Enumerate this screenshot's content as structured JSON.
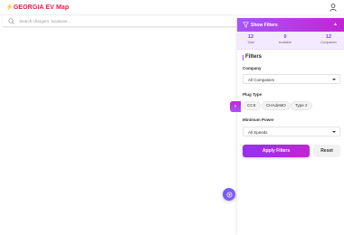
{
  "header": {
    "logo_text": "⚡GEORGIA EV Map",
    "user_icon": "user-icon"
  },
  "search": {
    "placeholder": "Search chargers, locations..."
  },
  "panel": {
    "title": "Show Filters",
    "collapse_glyph": "▲",
    "stats": [
      {
        "value": "12",
        "label": "Total"
      },
      {
        "value": "0",
        "label": "Available"
      },
      {
        "value": "12",
        "label": "Companies"
      }
    ],
    "filters_title": "Filters",
    "company": {
      "label": "Company",
      "selected": "All Companies"
    },
    "plug_type": {
      "label": "Plug Type",
      "options": [
        "CCS",
        "CHAdeMO",
        "Type 2"
      ]
    },
    "min_power": {
      "label": "Minimum Power",
      "selected": "All Speeds"
    },
    "apply_label": "Apply Filters",
    "reset_label": "Reset"
  },
  "side_toggle": {
    "glyph": "›"
  },
  "colors": {
    "brand": "#e11d48",
    "accent": "#a855f7",
    "accent2": "#c026d3",
    "fab": "#6d5cf5"
  }
}
